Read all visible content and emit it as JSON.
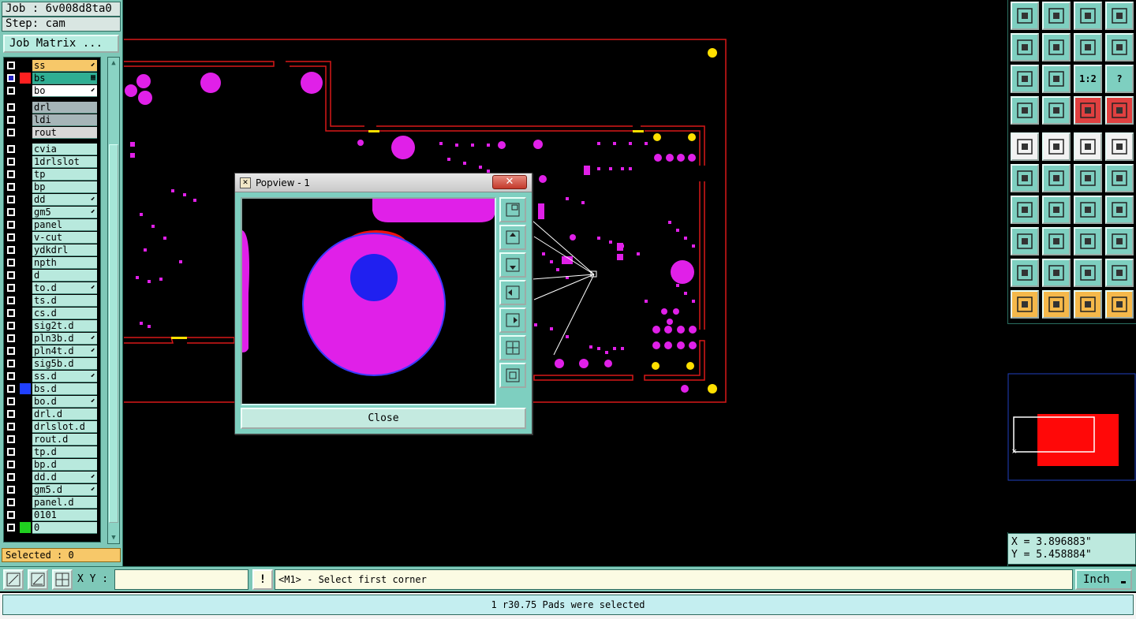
{
  "left_panel": {
    "job_label": "Job : 6v008d8ta0",
    "step_label": "Step: cam",
    "job_matrix_button": "Job Matrix ...",
    "layer_groups": [
      [
        {
          "name": "ss",
          "bg": "#f7c869",
          "swatch": "",
          "mark": "⬋"
        },
        {
          "name": "bs",
          "bg": "#2fae93",
          "swatch": "#ff2020",
          "mark": "▦",
          "active": true
        },
        {
          "name": "bo",
          "bg": "#ffffff",
          "swatch": "",
          "mark": "⬋"
        }
      ],
      [
        {
          "name": "drl",
          "bg": "#a6b5b8",
          "swatch": "",
          "mark": ""
        },
        {
          "name": "ldi",
          "bg": "#a6b5b8",
          "swatch": "",
          "mark": ""
        },
        {
          "name": "rout",
          "bg": "#d8d8d8",
          "swatch": "",
          "mark": ""
        }
      ],
      [
        {
          "name": "cvia",
          "bg": "#b8e9dd",
          "swatch": "",
          "mark": ""
        },
        {
          "name": "1drlslot",
          "bg": "#b8e9dd",
          "swatch": "",
          "mark": ""
        },
        {
          "name": "tp",
          "bg": "#b8e9dd",
          "swatch": "",
          "mark": ""
        },
        {
          "name": "bp",
          "bg": "#b8e9dd",
          "swatch": "",
          "mark": ""
        },
        {
          "name": "dd",
          "bg": "#b8e9dd",
          "swatch": "",
          "mark": "⬋"
        },
        {
          "name": "gm5",
          "bg": "#b8e9dd",
          "swatch": "",
          "mark": "⬋"
        },
        {
          "name": "panel",
          "bg": "#b8e9dd",
          "swatch": "",
          "mark": ""
        },
        {
          "name": "v-cut",
          "bg": "#b8e9dd",
          "swatch": "",
          "mark": ""
        },
        {
          "name": "ydkdrl",
          "bg": "#b8e9dd",
          "swatch": "",
          "mark": ""
        },
        {
          "name": "npth",
          "bg": "#b8e9dd",
          "swatch": "",
          "mark": ""
        },
        {
          "name": "d",
          "bg": "#b8e9dd",
          "swatch": "",
          "mark": ""
        },
        {
          "name": "to.d",
          "bg": "#b8e9dd",
          "swatch": "",
          "mark": "⬋"
        },
        {
          "name": "ts.d",
          "bg": "#b8e9dd",
          "swatch": "",
          "mark": ""
        },
        {
          "name": "cs.d",
          "bg": "#b8e9dd",
          "swatch": "",
          "mark": ""
        },
        {
          "name": "sig2t.d",
          "bg": "#b8e9dd",
          "swatch": "",
          "mark": ""
        },
        {
          "name": "pln3b.d",
          "bg": "#b8e9dd",
          "swatch": "",
          "mark": "⬋"
        },
        {
          "name": "pln4t.d",
          "bg": "#b8e9dd",
          "swatch": "",
          "mark": "⬋"
        },
        {
          "name": "sig5b.d",
          "bg": "#b8e9dd",
          "swatch": "",
          "mark": ""
        },
        {
          "name": "ss.d",
          "bg": "#b8e9dd",
          "swatch": "",
          "mark": "⬋"
        },
        {
          "name": "bs.d",
          "bg": "#b8e9dd",
          "swatch": "#2040ff",
          "mark": ""
        },
        {
          "name": "bo.d",
          "bg": "#b8e9dd",
          "swatch": "",
          "mark": "⬋"
        },
        {
          "name": "drl.d",
          "bg": "#b8e9dd",
          "swatch": "",
          "mark": ""
        },
        {
          "name": "drlslot.d",
          "bg": "#b8e9dd",
          "swatch": "",
          "mark": ""
        },
        {
          "name": "rout.d",
          "bg": "#b8e9dd",
          "swatch": "",
          "mark": ""
        },
        {
          "name": "tp.d",
          "bg": "#b8e9dd",
          "swatch": "",
          "mark": ""
        },
        {
          "name": "bp.d",
          "bg": "#b8e9dd",
          "swatch": "",
          "mark": ""
        },
        {
          "name": "dd.d",
          "bg": "#b8e9dd",
          "swatch": "",
          "mark": "⬋"
        },
        {
          "name": "gm5.d",
          "bg": "#b8e9dd",
          "swatch": "",
          "mark": "⬋"
        },
        {
          "name": "panel.d",
          "bg": "#b8e9dd",
          "swatch": "",
          "mark": ""
        },
        {
          "name": "0101",
          "bg": "#b8e9dd",
          "swatch": "",
          "mark": ""
        },
        {
          "name": "0",
          "bg": "#b8e9dd",
          "swatch": "#20d020",
          "mark": ""
        }
      ]
    ],
    "selected_label": "Selected : 0"
  },
  "popview": {
    "title": "Popview - 1",
    "close_button": "Close"
  },
  "toolbar": {
    "tools": [
      {
        "name": "home-icon",
        "color": "teal"
      },
      {
        "name": "save-icon",
        "color": "teal"
      },
      {
        "name": "house-icon",
        "color": "teal"
      },
      {
        "name": "window-icon",
        "color": "teal"
      },
      {
        "name": "pan-left-icon",
        "color": "teal"
      },
      {
        "name": "pan-right-icon",
        "color": "teal"
      },
      {
        "name": "zoom-in-icon",
        "color": "teal"
      },
      {
        "name": "zoom-out-icon",
        "color": "teal"
      },
      {
        "name": "fit-icon",
        "color": "teal"
      },
      {
        "name": "zoom-fit-icon",
        "color": "teal"
      },
      {
        "name": "ratio-icon",
        "color": "teal",
        "text": "1:2"
      },
      {
        "name": "help-icon",
        "color": "teal",
        "text": "?"
      },
      {
        "name": "settings-icon",
        "color": "teal"
      },
      {
        "name": "probe-icon",
        "color": "teal"
      },
      {
        "name": "net-icon",
        "color": "red"
      },
      {
        "name": "net-select-icon",
        "color": "red"
      },
      {
        "name": "snap-icon",
        "color": "white"
      },
      {
        "name": "area-icon",
        "color": "white"
      },
      {
        "name": "measure-icon",
        "color": "white"
      },
      {
        "name": "pad-icon",
        "color": "white"
      },
      {
        "name": "connect-icon",
        "color": "teal"
      },
      {
        "name": "cross-icon",
        "color": "teal"
      },
      {
        "name": "point-to-point-icon",
        "color": "teal"
      },
      {
        "name": "point-to-pad-icon",
        "color": "teal"
      },
      {
        "name": "angle-icon",
        "color": "teal"
      },
      {
        "name": "line-icon",
        "color": "teal"
      },
      {
        "name": "rotate-icon",
        "color": "teal"
      },
      {
        "name": "mirror-icon",
        "color": "teal"
      },
      {
        "name": "pad-select-icon",
        "color": "teal"
      },
      {
        "name": "line-select-icon",
        "color": "teal"
      },
      {
        "name": "spacing-icon",
        "color": "teal"
      },
      {
        "name": "shapes-icon",
        "color": "teal"
      },
      {
        "name": "triangle-icon",
        "color": "teal"
      },
      {
        "name": "triangle-red-icon",
        "color": "teal"
      },
      {
        "name": "arch-icon",
        "color": "teal"
      },
      {
        "name": "arch-wide-icon",
        "color": "teal"
      },
      {
        "name": "pointer-icon",
        "color": "orange"
      },
      {
        "name": "pointer-box-icon",
        "color": "orange"
      },
      {
        "name": "pointer-shape-icon",
        "color": "orange"
      },
      {
        "name": "route-icon",
        "color": "orange"
      }
    ]
  },
  "coords": {
    "x": "X = 3.896883\"",
    "y": "Y = 5.458884\""
  },
  "bottom": {
    "xy_label": "X Y :",
    "xy_value": "",
    "warn_label": "!",
    "prompt": "<M1> - Select first corner",
    "unit": "Inch"
  },
  "status": {
    "message": "1 r30.75 Pads were selected"
  }
}
